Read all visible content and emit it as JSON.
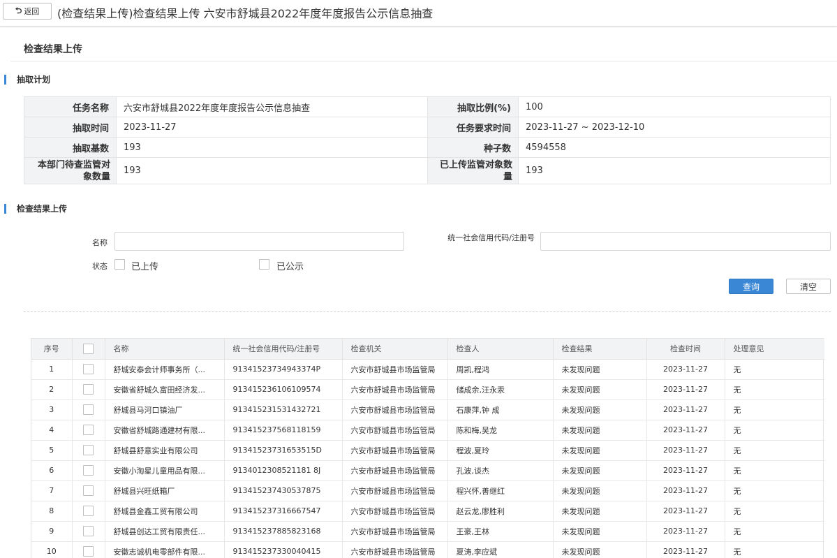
{
  "header": {
    "back_label": "返回",
    "back_icon": "return-arrow-icon",
    "title": "(检查结果上传)检查结果上传 六安市舒城县2022年度年度报告公示信息抽查"
  },
  "sub_title": "检查结果上传",
  "plan_section": {
    "title": "抽取计划",
    "rows": [
      {
        "l1": "任务名称",
        "v1": "六安市舒城县2022年度年度报告公示信息抽查",
        "l2": "抽取比例(%)",
        "v2": "100"
      },
      {
        "l1": "抽取时间",
        "v1": "2023-11-27",
        "l2": "任务要求时间",
        "v2": "2023-11-27 ~ 2023-12-10"
      },
      {
        "l1": "抽取基数",
        "v1": "193",
        "l2": "种子数",
        "v2": "4594558"
      },
      {
        "l1": "本部门待查监管对象数量",
        "v1": "193",
        "l2": "已上传监管对象数量",
        "v2": "193"
      }
    ]
  },
  "upload_section": {
    "title": "检查结果上传",
    "name_label": "名称",
    "name_value": "",
    "code_label": "统一社会信用代码/注册号",
    "code_value": "",
    "status_label": "状态",
    "status_options": [
      "已上传",
      "已公示"
    ],
    "query_label": "查询",
    "clear_label": "清空"
  },
  "results": {
    "columns": [
      "序号",
      "",
      "名称",
      "统一社会信用代码/注册号",
      "检查机关",
      "检查人",
      "检查结果",
      "检查时间",
      "处理意见"
    ],
    "rows": [
      {
        "no": "1",
        "name": "舒城安泰会计师事务所（...",
        "code": "91341523734943374P",
        "org": "六安市舒城县市场监管局",
        "inspector": "周凯,程鸿",
        "result": "未发现问题",
        "date": "2023-11-27",
        "opinion": "无"
      },
      {
        "no": "2",
        "name": "安徽省舒城久富田经济发...",
        "code": "913415236106109574",
        "org": "六安市舒城县市场监管局",
        "inspector": "储成余,汪永汞",
        "result": "未发现问题",
        "date": "2023-11-27",
        "opinion": "无"
      },
      {
        "no": "3",
        "name": "舒城县马河口镇油厂",
        "code": "913415231531432721",
        "org": "六安市舒城县市场监管局",
        "inspector": "石康萍,钟 成",
        "result": "未发现问题",
        "date": "2023-11-27",
        "opinion": "无"
      },
      {
        "no": "4",
        "name": "安徽省舒城路通建材有限...",
        "code": "913415237568118159",
        "org": "六安市舒城县市场监管局",
        "inspector": "陈和梅,吴龙",
        "result": "未发现问题",
        "date": "2023-11-27",
        "opinion": "无"
      },
      {
        "no": "5",
        "name": "舒城县舒意实业有限公司",
        "code": "91341523731653515D",
        "org": "六安市舒城县市场监管局",
        "inspector": "程波,夏玲",
        "result": "未发现问题",
        "date": "2023-11-27",
        "opinion": "无"
      },
      {
        "no": "6",
        "name": "安徽小淘星儿童用品有限...",
        "code": "9134012308521181 8J",
        "org": "六安市舒城县市场监管局",
        "inspector": "孔波,谈杰",
        "result": "未发现问题",
        "date": "2023-11-27",
        "opinion": "无"
      },
      {
        "no": "7",
        "name": "舒城县兴旺纸箱厂",
        "code": "913415237430537875",
        "org": "六安市舒城县市场监管局",
        "inspector": "程兴怀,善继红",
        "result": "未发现问题",
        "date": "2023-11-27",
        "opinion": "无"
      },
      {
        "no": "8",
        "name": "舒城县金鑫工贸有限公司",
        "code": "913415237316667547",
        "org": "六安市舒城县市场监管局",
        "inspector": "赵云龙,廖胜利",
        "result": "未发现问题",
        "date": "2023-11-27",
        "opinion": "无"
      },
      {
        "no": "9",
        "name": "舒城县创达工贸有限责任...",
        "code": "913415237885823168",
        "org": "六安市舒城县市场监管局",
        "inspector": "王豪,王林",
        "result": "未发现问题",
        "date": "2023-11-27",
        "opinion": "无"
      },
      {
        "no": "10",
        "name": "安徽志诚机电零部件有限...",
        "code": "913415237330040415",
        "org": "六安市舒城县市场监管局",
        "inspector": "夏涛,李应斌",
        "result": "未发现问题",
        "date": "2023-11-27",
        "opinion": "无"
      }
    ]
  },
  "colors": {
    "accent": "#3a87d6",
    "header_bg": "#f2f3f5",
    "border": "#e4e4e4"
  }
}
